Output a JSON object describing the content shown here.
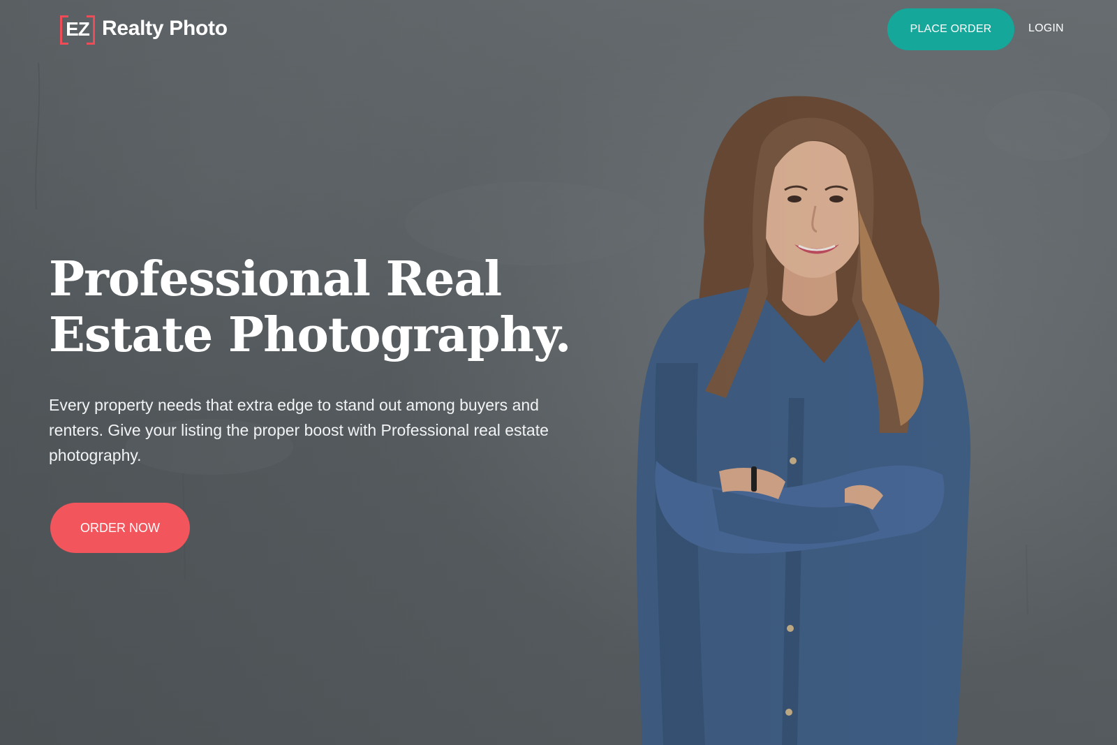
{
  "brand": {
    "logo_mark": "EZ",
    "name": "Realty Photo",
    "accent_color": "#ef4c57"
  },
  "nav": {
    "place_order_label": "PLACE ORDER",
    "place_order_color": "#16a79b",
    "login_label": "LOGIN"
  },
  "hero": {
    "headline": "Professional Real Estate Photography.",
    "subcopy": "Every property needs that extra edge to stand out among buyers and renters. Give your listing the proper boost with Professional real estate photography.",
    "cta_label": "ORDER NOW",
    "cta_color": "#f2555c"
  }
}
